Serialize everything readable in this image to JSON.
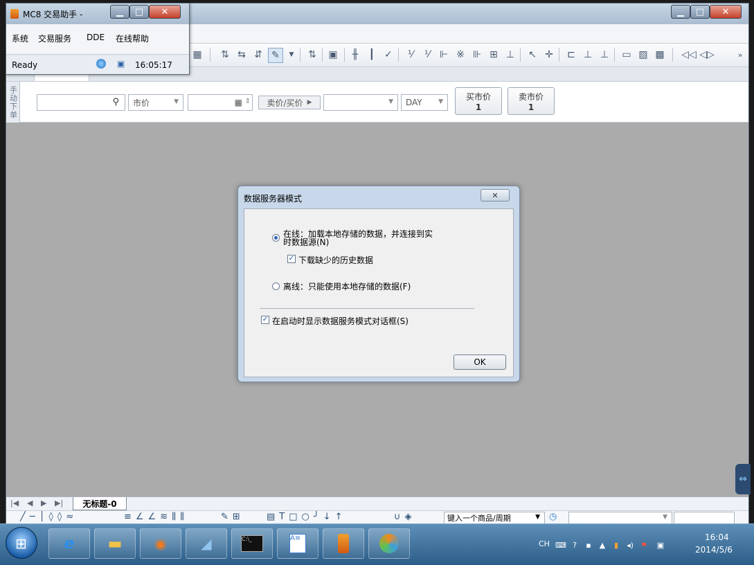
{
  "assistant": {
    "title": "MC8 交易助手 -",
    "menu": [
      "系统",
      "交易服务",
      "DDE",
      "在线帮助"
    ],
    "status": "Ready",
    "time": "16:05:17"
  },
  "order_bar": {
    "side_tab": "手动下单",
    "price_type": "市价",
    "sell_buy_label": "卖价/买价",
    "tif": "DAY",
    "buy_market": {
      "label": "买市价",
      "qty": "1"
    },
    "sell_market": {
      "label": "卖市价",
      "qty": "1"
    }
  },
  "dialog": {
    "title": "数据服务器模式",
    "online_option": "在线：加载本地存储的数据，并连接到实时数据源(N)",
    "online_line1": "在线：加载本地存储的数据，并连接到实",
    "online_line2": "时数据源(N)",
    "download_missing": "下载缺少的历史数据",
    "offline_option": "离线：只能使用本地存储的数据(F)",
    "show_on_startup": "在启动时显示数据服务模式对话框(S)",
    "ok": "OK",
    "online_selected": true,
    "download_checked": true,
    "startup_checked": true
  },
  "sheet_tabs": {
    "active_tab": "无标题-0"
  },
  "draw_toolbar": {
    "symbol_input_placeholder": "键入一个商品/周期"
  },
  "taskbar": {
    "lang": "CH",
    "time": "16:04",
    "date": "2014/5/6"
  },
  "colors": {
    "workspace_bg": "#ababab",
    "taskbar": "#3a6d99",
    "dialog_frame": "#c8d8ea"
  }
}
